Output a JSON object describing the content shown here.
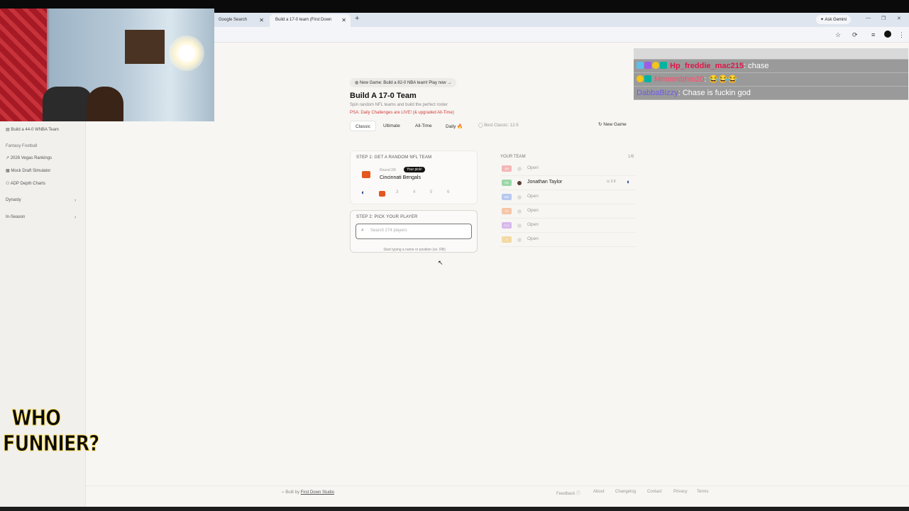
{
  "browser": {
    "tabs": [
      {
        "label": "Google Search"
      },
      {
        "label": "Build a 17-0 team (First Down"
      }
    ],
    "new_tab": "+",
    "ask_gemini": "✦ Ask Gemini",
    "tab_close": "✕"
  },
  "webcam_overlay": {
    "present": true
  },
  "chat": {
    "lines": [
      {
        "user": "Hp_freddie_mac215",
        "message": ": chase"
      },
      {
        "user": "Mmmmbhm20",
        "message": ": 😂😂😂"
      },
      {
        "user": "DabbaBizzy",
        "message": ": Chase is fuckin god"
      }
    ]
  },
  "stream_logo": {
    "line1": "WHO",
    "line2": "FUNNIER?"
  },
  "sidebar": {
    "top_item": "Build a 44-0 WNBA Team",
    "section_title": "Fantasy Football",
    "items": [
      "2026 Vegas Rankings",
      "Mock Draft Simulator",
      "ADP Depth Charts"
    ],
    "groups": [
      "Dynasty",
      "In-Season"
    ]
  },
  "main": {
    "banner": "New Game: Build a 82-0 NBA team! Play now →",
    "title": "Build A 17-0 Team",
    "subtitle": "Spin random NFL teams and build the perfect roster",
    "psa": "PSA: Daily Challenges are LIVE! (& upgraded All-Time)",
    "modes": [
      "Classic",
      "Ultimate",
      "All-Time",
      "Daily 🔥"
    ],
    "best": "Best Classic: 12-5",
    "new_game": "↻ New Game"
  },
  "step1": {
    "label": "STEP 1: GET A RANDOM NFL TEAM",
    "round": "Round 2/6",
    "badge": "Your pick!",
    "team": "Cincinnati Bengals",
    "roll_numbers": [
      "3",
      "4",
      "5",
      "6"
    ]
  },
  "step2": {
    "label": "STEP 2: PICK YOUR PLAYER",
    "placeholder": "Search 274 players",
    "hint": "Start typing a name or position (ex. RB)"
  },
  "your_team": {
    "title": "YOUR TEAM",
    "count": "1/6",
    "slots": [
      {
        "pos": "QB",
        "text": "Open",
        "color": "#f4b6b6"
      },
      {
        "pos": "RB",
        "text": "Jonathan Taylor",
        "color": "#9bd7a8",
        "meta": "⊙ 2.0"
      },
      {
        "pos": "WR",
        "text": "Open",
        "color": "#b8c9f0"
      },
      {
        "pos": "TE",
        "text": "Open",
        "color": "#f5c6a8"
      },
      {
        "pos": "FLX",
        "text": "Open",
        "color": "#d8b8ec"
      },
      {
        "pos": "K",
        "text": "Open",
        "color": "#f3d9a2"
      }
    ]
  },
  "footer": {
    "built_by": "Built by",
    "studio": "First Down Studio",
    "links": [
      "Feedback ⓘ",
      "About",
      "Changelog",
      "Contact",
      "Privacy",
      "Terms"
    ]
  }
}
